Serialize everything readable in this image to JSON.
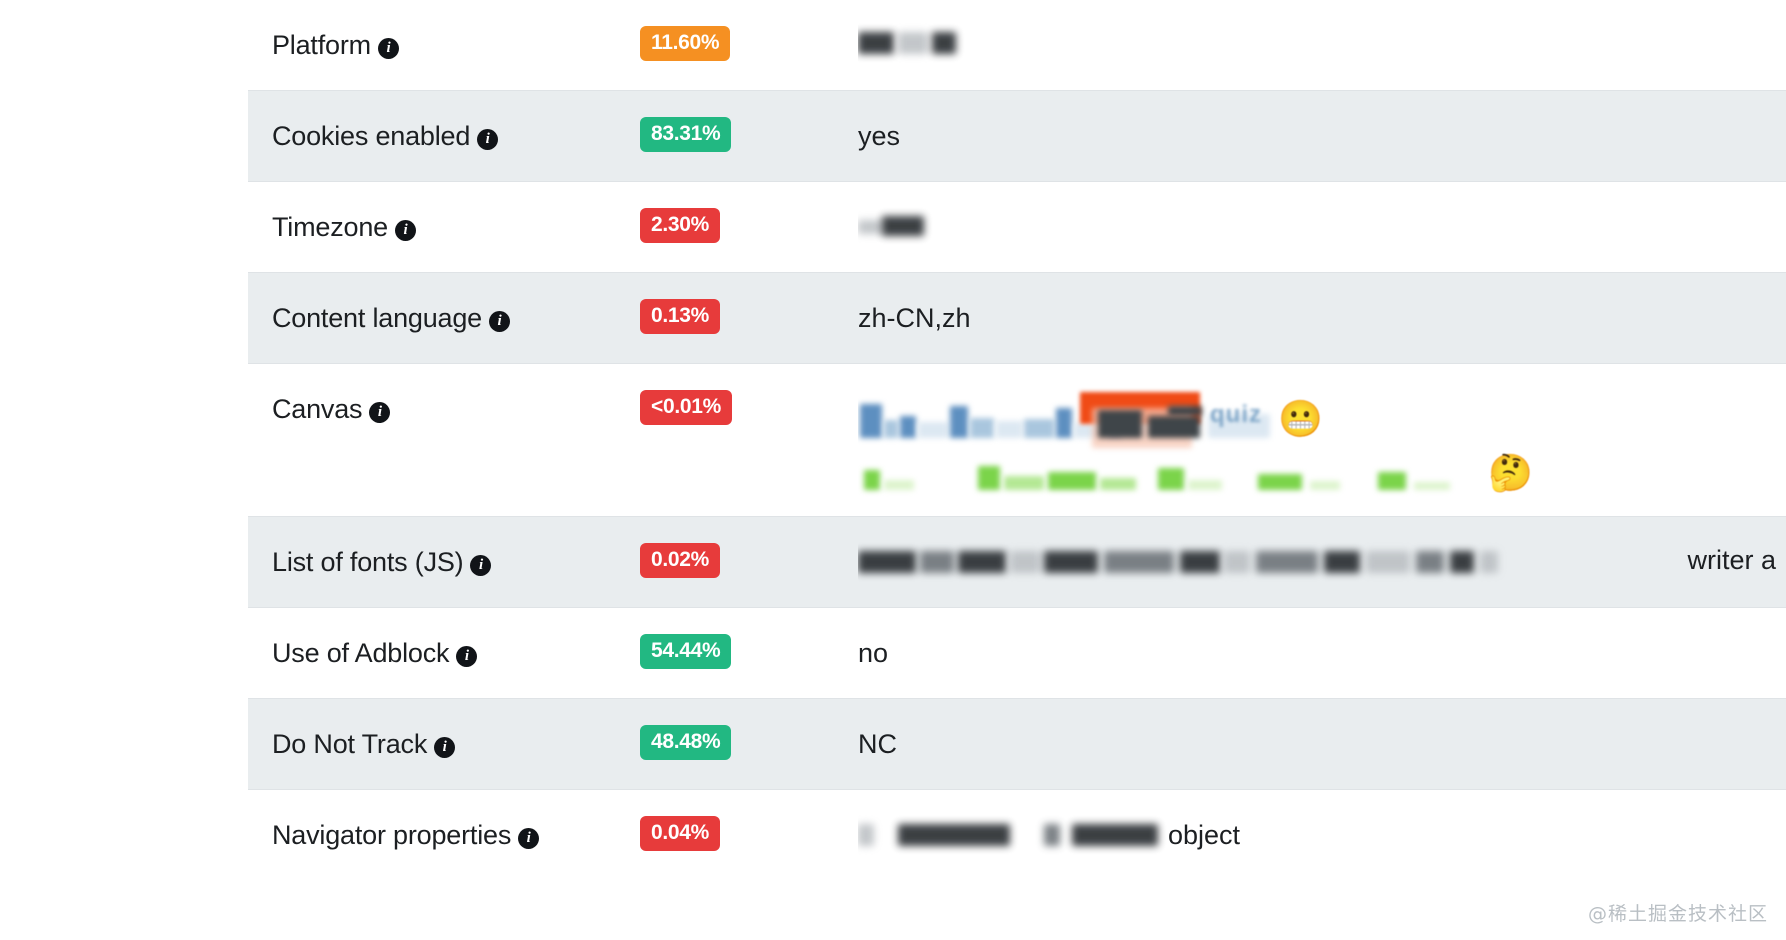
{
  "table": {
    "rows": [
      {
        "attribute": "Platform",
        "percentage": "11.60%",
        "badge_color": "#f59022",
        "striped": false,
        "value_kind": "blurred",
        "value_text": ""
      },
      {
        "attribute": "Cookies enabled",
        "percentage": "83.31%",
        "badge_color": "#22b882",
        "striped": true,
        "value_kind": "text",
        "value_text": "yes"
      },
      {
        "attribute": "Timezone",
        "percentage": "2.30%",
        "badge_color": "#e73b3b",
        "striped": false,
        "value_kind": "blurred",
        "value_text": ""
      },
      {
        "attribute": "Content language",
        "percentage": "0.13%",
        "badge_color": "#e73b3b",
        "striped": true,
        "value_kind": "text",
        "value_text": "zh-CN,zh"
      },
      {
        "attribute": "Canvas",
        "percentage": "<0.01%",
        "badge_color": "#e73b3b",
        "striped": false,
        "value_kind": "canvas",
        "value_text": "quiz"
      },
      {
        "attribute": "List of fonts (JS)",
        "percentage": "0.02%",
        "badge_color": "#e73b3b",
        "striped": true,
        "value_kind": "fonts",
        "value_text": "writer a"
      },
      {
        "attribute": "Use of Adblock",
        "percentage": "54.44%",
        "badge_color": "#22b882",
        "striped": false,
        "value_kind": "text",
        "value_text": "no"
      },
      {
        "attribute": "Do Not Track",
        "percentage": "48.48%",
        "badge_color": "#22b882",
        "striped": true,
        "value_kind": "text",
        "value_text": "NC"
      },
      {
        "attribute": "Navigator properties",
        "percentage": "0.04%",
        "badge_color": "#e73b3b",
        "striped": false,
        "value_kind": "navigator",
        "value_text": "object"
      }
    ],
    "info_icon_glyph": "i",
    "info_icon_name": "info-icon"
  },
  "watermark": {
    "text": "@稀土掘金技术社区"
  }
}
